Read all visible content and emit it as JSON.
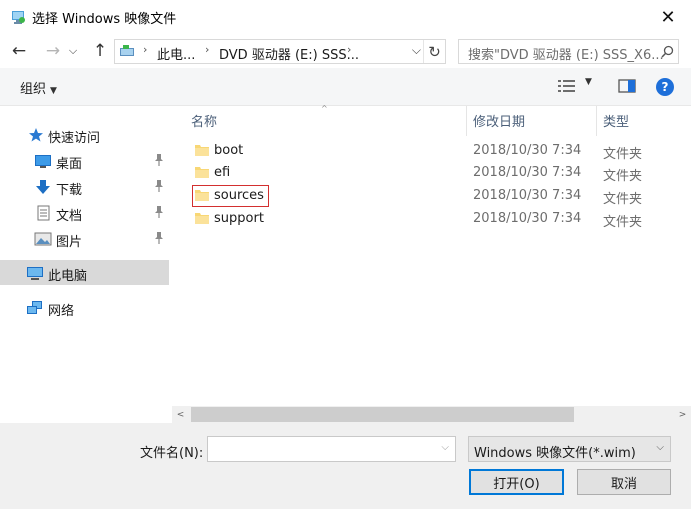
{
  "window": {
    "title": "选择 Windows 映像文件",
    "close_glyph": "✕"
  },
  "nav": {
    "back_glyph": "←",
    "forward_glyph": "→",
    "history_glyph": "⌵",
    "up_glyph": "↑",
    "address": {
      "crumbs": [
        "此电...",
        "DVD 驱动器 (E:) SSS..."
      ],
      "separator": "›",
      "dropdown_glyph": "⌵",
      "refresh_glyph": "↻"
    },
    "search_placeholder": "搜索\"DVD 驱动器 (E:) SSS_X6..."
  },
  "toolbar": {
    "organize_label": "组织",
    "organize_caret": "▼",
    "view_caret": "▼",
    "help_glyph": "?"
  },
  "sidebar": {
    "quick_access": {
      "label": "快速访问",
      "icon": "star-icon"
    },
    "pinned": [
      {
        "label": "桌面",
        "icon": "desktop-icon"
      },
      {
        "label": "下载",
        "icon": "download-icon"
      },
      {
        "label": "文档",
        "icon": "document-icon"
      },
      {
        "label": "图片",
        "icon": "pictures-icon"
      }
    ],
    "this_pc": {
      "label": "此电脑",
      "icon": "computer-icon"
    },
    "network": {
      "label": "网络",
      "icon": "network-icon"
    }
  },
  "filelist": {
    "columns": [
      "名称",
      "修改日期",
      "类型"
    ],
    "sort_glyph": "^",
    "rows": [
      {
        "name": "boot",
        "date": "2018/10/30 7:34",
        "type": "文件夹"
      },
      {
        "name": "efi",
        "date": "2018/10/30 7:34",
        "type": "文件夹"
      },
      {
        "name": "sources",
        "date": "2018/10/30 7:34",
        "type": "文件夹"
      },
      {
        "name": "support",
        "date": "2018/10/30 7:34",
        "type": "文件夹"
      }
    ],
    "highlighted_row": "sources"
  },
  "scrollbar": {
    "left_glyph": "<",
    "right_glyph": ">"
  },
  "bottom": {
    "filename_label": "文件名(N):",
    "filename_value": "",
    "filename_dd": "⌵",
    "filter_value": "Windows 映像文件(*.wim)",
    "filter_dd": "⌵",
    "open_label": "打开(O)",
    "cancel_label": "取消"
  },
  "colors": {
    "accent": "#0078d7",
    "help": "#1e6fd9",
    "folder": "#f8d775",
    "highlight_border": "#d32f2f",
    "selected_bg": "#d9d9d9"
  }
}
